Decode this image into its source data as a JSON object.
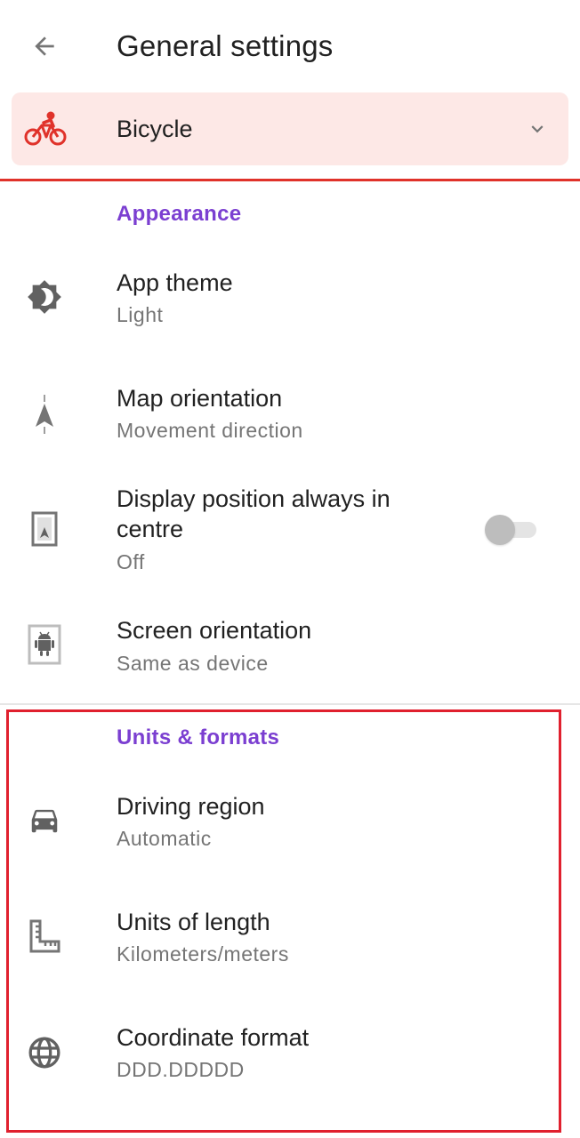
{
  "header": {
    "title": "General settings",
    "back_icon": "arrow-left-icon"
  },
  "profile": {
    "label": "Bicycle",
    "icon": "bicycle-icon",
    "accent_color": "#e0322a",
    "background_color": "#fde8e6"
  },
  "sections": {
    "appearance": {
      "title": "Appearance",
      "items": {
        "app_theme": {
          "label": "App theme",
          "value": "Light",
          "icon": "theme-icon"
        },
        "map_orientation": {
          "label": "Map orientation",
          "value": "Movement direction",
          "icon": "navigation-arrow-icon"
        },
        "display_position": {
          "label_line1": "Display position always in",
          "label_line2": "centre",
          "value": "Off",
          "icon": "map-position-icon",
          "toggle_on": false
        },
        "screen_orientation": {
          "label": "Screen orientation",
          "value": "Same as device",
          "icon": "android-device-icon"
        }
      }
    },
    "units_formats": {
      "title": "Units & formats",
      "items": {
        "driving_region": {
          "label": "Driving region",
          "value": "Automatic",
          "icon": "car-icon"
        },
        "units_of_length": {
          "label": "Units of length",
          "value": "Kilometers/meters",
          "icon": "ruler-icon"
        },
        "coordinate_format": {
          "label": "Coordinate format",
          "value": "DDD.DDDDD",
          "icon": "globe-icon"
        }
      }
    }
  },
  "colors": {
    "section_header": "#7b3fd1",
    "highlight_box": "#e0202e"
  }
}
